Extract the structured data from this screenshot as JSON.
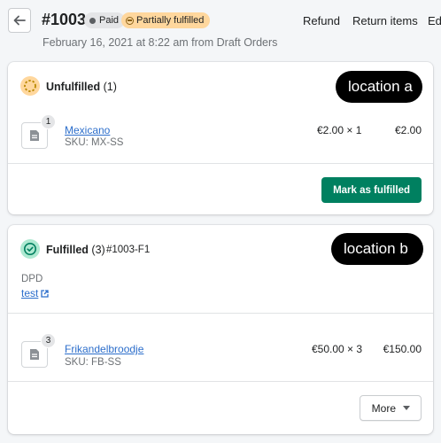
{
  "header": {
    "order_number": "#1003",
    "payment_badge": "Paid",
    "fulfillment_badge": "Partially fulfilled",
    "subtitle": "February 16, 2021 at 8:22 am from Draft Orders",
    "actions": {
      "refund": "Refund",
      "return_items": "Return items",
      "edit": "Edit"
    }
  },
  "unfulfilled": {
    "title": "Unfulfilled",
    "count": "(1)",
    "callout": "location a",
    "item": {
      "quantity": "1",
      "name": "Mexicano",
      "sku": "SKU: MX-SS",
      "price_qty": "€2.00 × 1",
      "total": "€2.00"
    },
    "action_label": "Mark as fulfilled"
  },
  "fulfilled": {
    "title": "Fulfilled",
    "count": "(3)",
    "fulfillment_id": "#1003-F1",
    "callout": "location b",
    "carrier": "DPD",
    "tracking_link": "test",
    "item": {
      "quantity": "3",
      "name": "Frikandelbroodje",
      "sku": "SKU: FB-SS",
      "price_qty": "€50.00 × 3",
      "total": "€150.00"
    },
    "more_label": "More"
  },
  "colors": {
    "primary_button": "#008060",
    "link": "#2c6ecb",
    "unfulfilled_badge": "#ffd79d",
    "fulfilled_badge": "#aee9d1",
    "callout_bg": "#000000"
  },
  "icons": [
    "back-arrow-icon",
    "paid-dot-icon",
    "partial-status-icon",
    "unfulfilled-status-icon",
    "fulfilled-check-icon",
    "product-image-icon",
    "external-link-icon",
    "caret-down-icon"
  ]
}
